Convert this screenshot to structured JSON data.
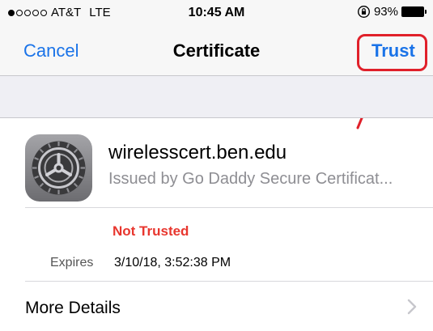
{
  "status_bar": {
    "carrier": "AT&T",
    "network": "LTE",
    "time": "10:45 AM",
    "battery": "93%",
    "signal_bars_filled": 1,
    "signal_bars_total": 5
  },
  "nav": {
    "cancel_label": "Cancel",
    "title": "Certificate",
    "trust_label": "Trust"
  },
  "certificate": {
    "name": "wirelesscert.ben.edu",
    "issuer": "Issued by Go Daddy Secure Certificat...",
    "icon": "settings-gear-icon",
    "status": "Not Trusted",
    "expires_label": "Expires",
    "expires_value": "3/10/18, 3:52:38 PM"
  },
  "more_details": {
    "label": "More Details",
    "icon": "chevron-right-icon"
  },
  "colors": {
    "accent": "#1a73e8",
    "not_trusted": "#e8362e",
    "annotation": "#e0202a"
  }
}
